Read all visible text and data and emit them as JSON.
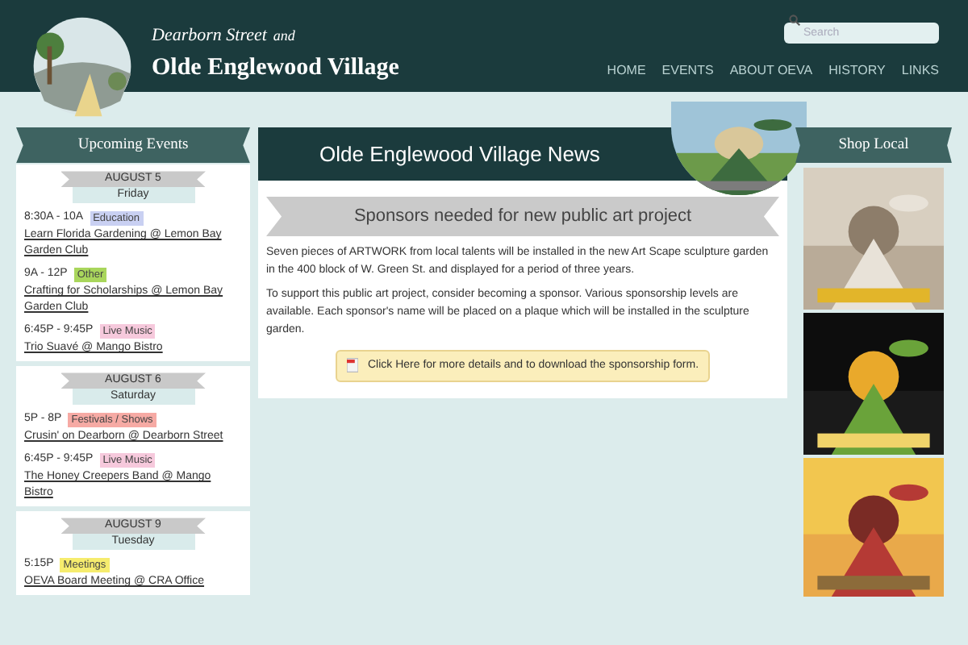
{
  "header": {
    "tagline": "Dearborn Street",
    "tagline_suffix": "and",
    "title": "Olde Englewood Village",
    "search": {
      "placeholder": "Search"
    },
    "nav": [
      "HOME",
      "EVENTS",
      "ABOUT OEVA",
      "HISTORY",
      "LINKS"
    ]
  },
  "events": {
    "title": "Upcoming Events",
    "days": [
      {
        "date": "AUGUST 5",
        "weekday": "Friday",
        "items": [
          {
            "time": "8:30A - 10A",
            "tag": "Education",
            "color": "#c9d0f2",
            "title": "Learn Florida Gardening @ Lemon Bay Garden Club"
          },
          {
            "time": "9A - 12P",
            "tag": "Other",
            "color": "#a9d65c",
            "title": "Crafting for Scholarships @ Lemon Bay Garden Club"
          },
          {
            "time": "6:45P - 9:45P",
            "tag": "Live Music",
            "color": "#f6c9dc",
            "title": "Trio Suavé @ Mango Bistro"
          }
        ]
      },
      {
        "date": "AUGUST 6",
        "weekday": "Saturday",
        "items": [
          {
            "time": "5P - 8P",
            "tag": "Festivals / Shows",
            "color": "#f6aaa4",
            "title": "Crusin' on Dearborn @ Dearborn Street"
          },
          {
            "time": "6:45P - 9:45P",
            "tag": "Live Music",
            "color": "#f6c9dc",
            "title": "The Honey Creepers Band @ Mango Bistro"
          }
        ]
      },
      {
        "date": "AUGUST 9",
        "weekday": "Tuesday",
        "items": [
          {
            "time": "5:15P",
            "tag": "Meetings",
            "color": "#f6ec6e",
            "title": "OEVA Board Meeting @ CRA Office"
          }
        ]
      }
    ]
  },
  "news": {
    "title": "Olde Englewood Village News",
    "headline": "Sponsors needed for new public art project",
    "paragraphs": [
      "Seven pieces of ARTWORK from local talents will be installed in the new Art Scape sculpture garden in the 400 block of W. Green St. and displayed for a period of three years.",
      "To support this public art project, consider becoming a sponsor. Various sponsorship levels are available. Each sponsor's name will be placed on a plaque which will be installed in the sculpture garden."
    ],
    "link": "Click Here for more details and to download the sponsorship form."
  },
  "shop": {
    "title": "Shop Local"
  }
}
